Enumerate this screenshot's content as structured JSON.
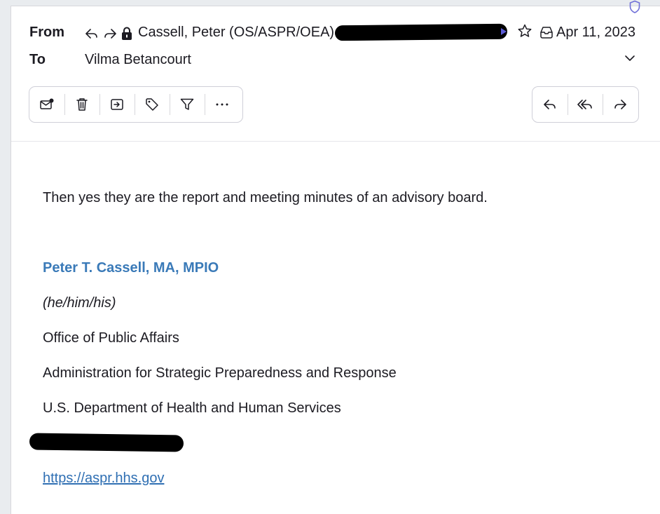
{
  "header": {
    "from_label": "From",
    "to_label": "To",
    "sender": "Cassell, Peter (OS/ASPR/OEA)",
    "recipient": "Vilma Betancourt",
    "date": "Apr 11, 2023"
  },
  "toolbar_left": [
    {
      "name": "mark-unread-icon",
      "title": "Mark as unread"
    },
    {
      "name": "trash-icon",
      "title": "Delete"
    },
    {
      "name": "move-icon",
      "title": "Move"
    },
    {
      "name": "tag-icon",
      "title": "Tag"
    },
    {
      "name": "filter-icon",
      "title": "Filter"
    },
    {
      "name": "more-icon",
      "title": "More"
    }
  ],
  "toolbar_right": [
    {
      "name": "reply-icon",
      "title": "Reply"
    },
    {
      "name": "reply-all-icon",
      "title": "Reply all"
    },
    {
      "name": "forward-icon",
      "title": "Forward"
    }
  ],
  "body": {
    "message": "Then yes they are the report and meeting minutes of an advisory board.",
    "signature_name": "Peter T. Cassell, MA, MPIO",
    "pronouns": "(he/him/his)",
    "office": "Office of Public Affairs",
    "administration": "Administration for Strategic Preparedness and Response",
    "department": "U.S. Department of Health and Human Services",
    "link": "https://aspr.hhs.gov"
  },
  "colors": {
    "signature_blue": "#3a7ab8",
    "link_blue": "#2f6fb3",
    "shield_purple": "#6f6fd8",
    "redaction": "#000000"
  }
}
